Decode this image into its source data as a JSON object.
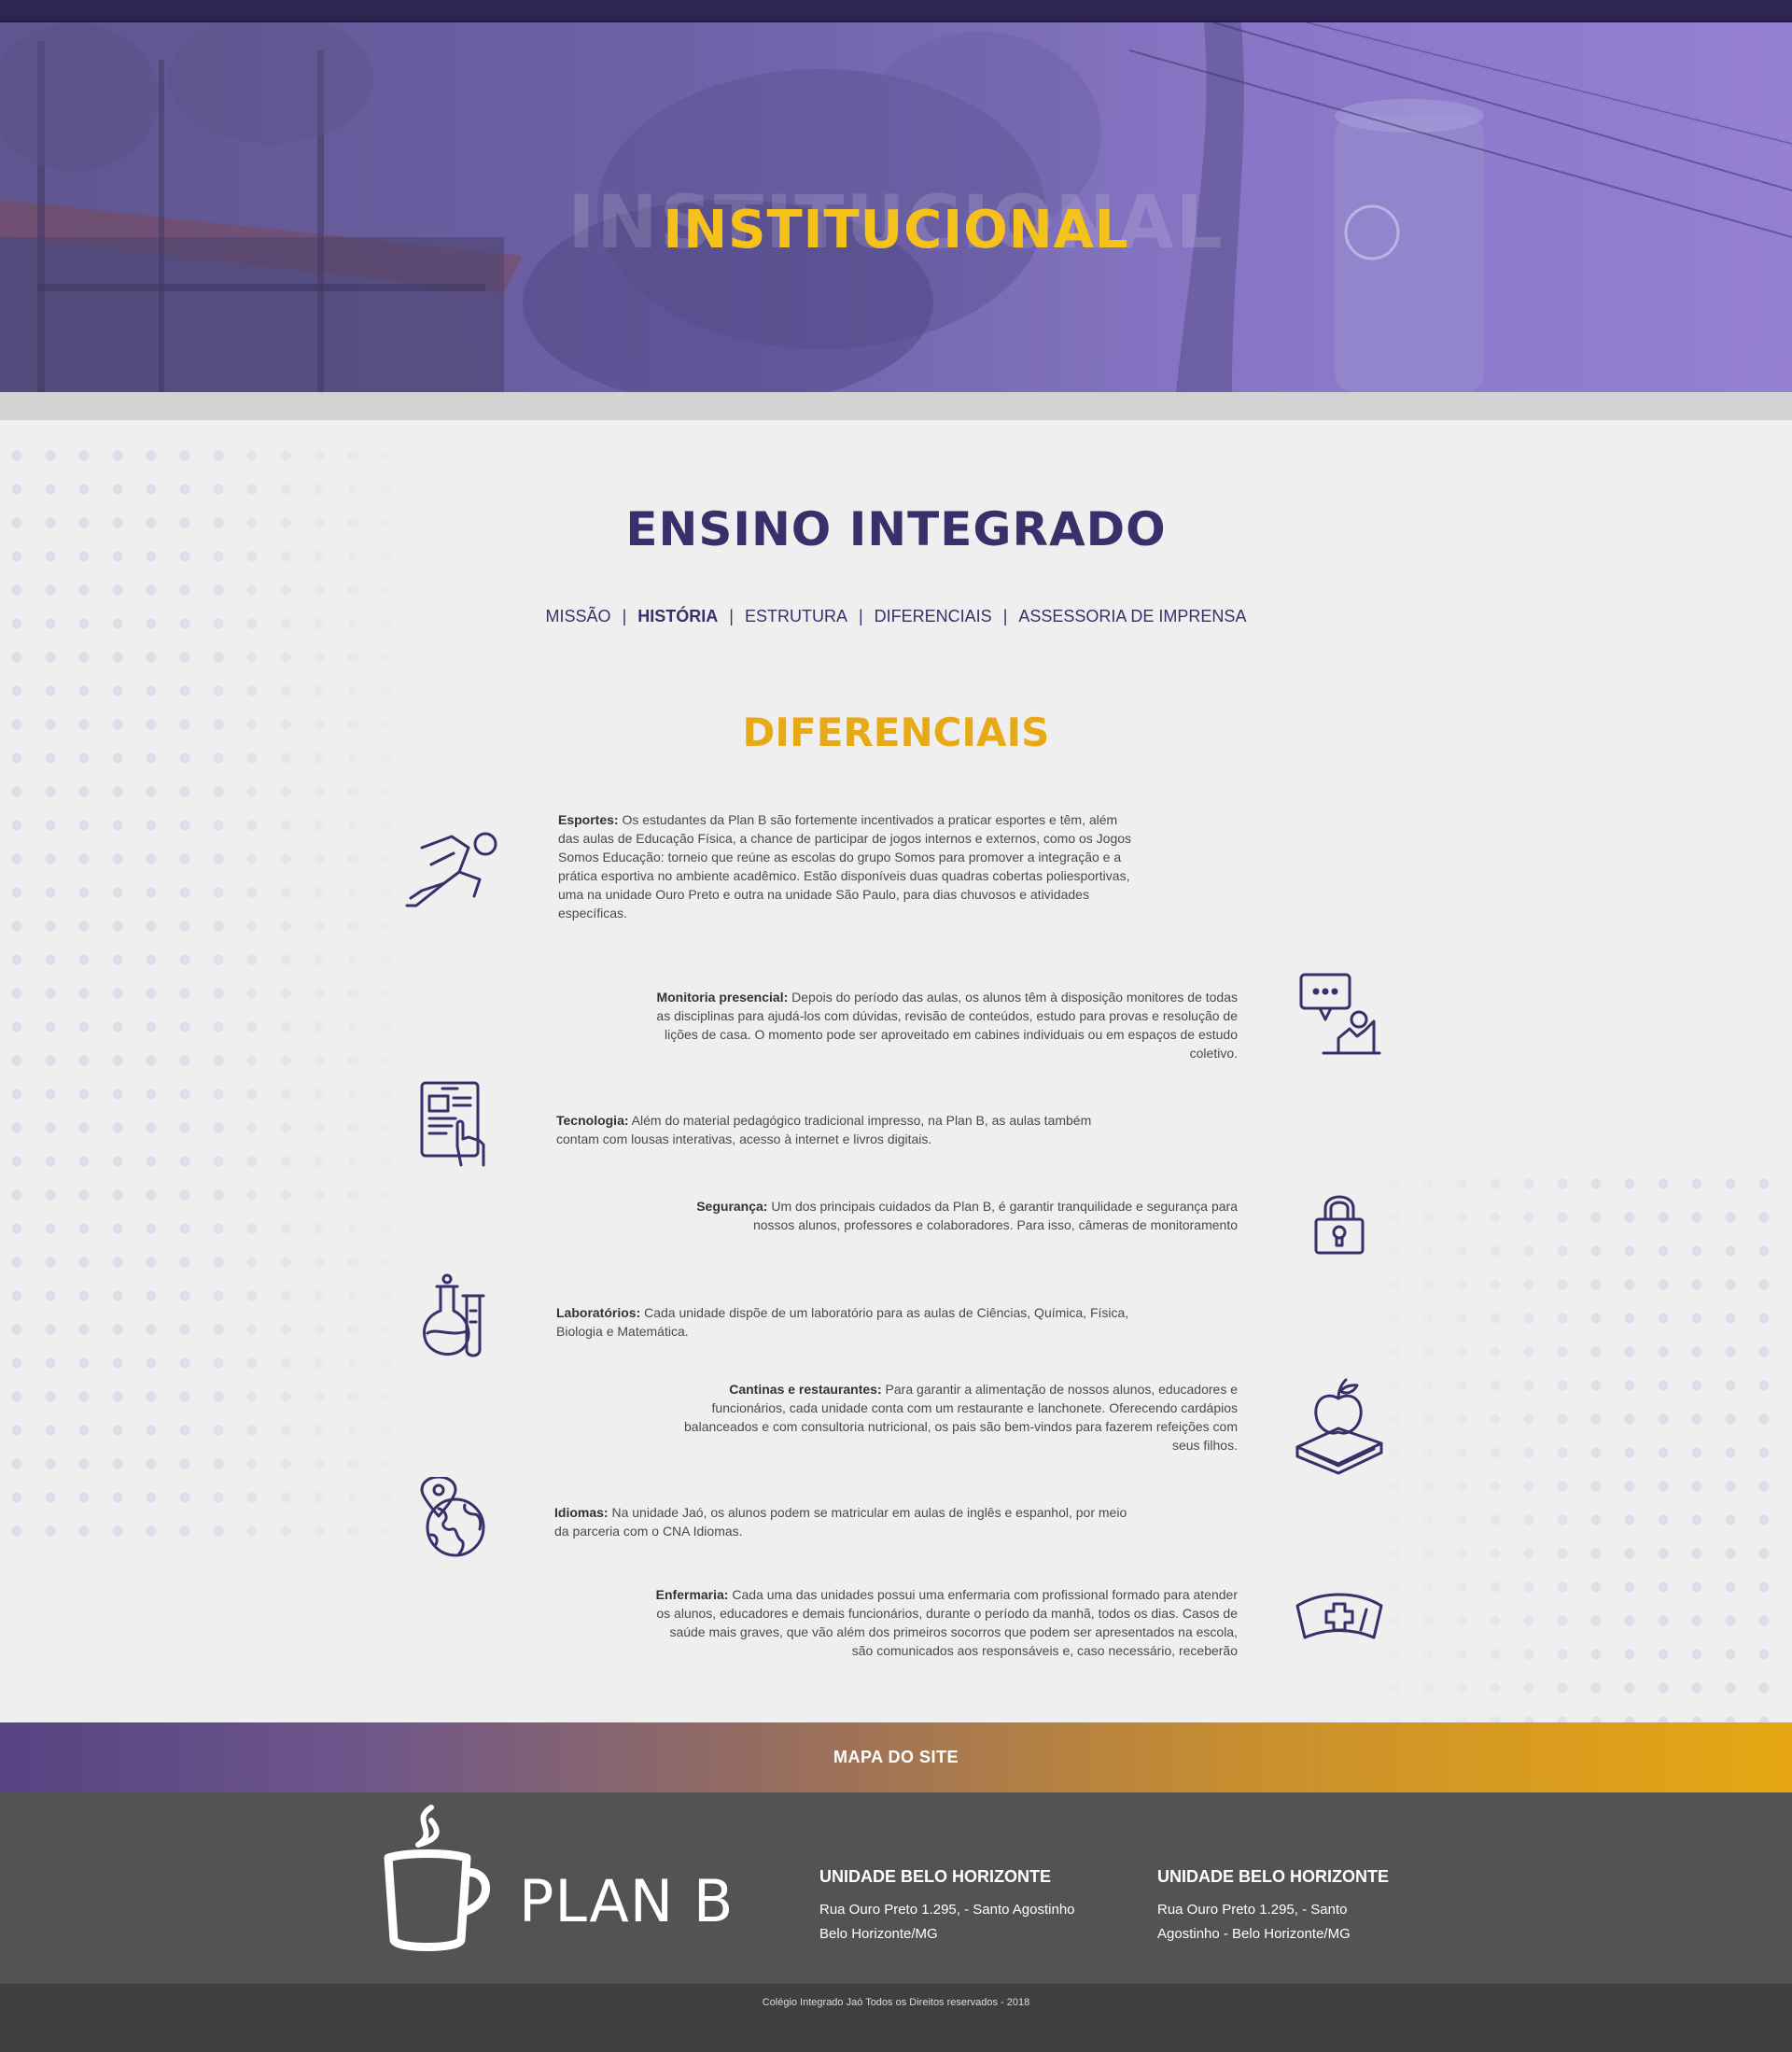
{
  "hero": {
    "ghost_title": "INSTITUCIONAL",
    "title": "INSTITUCIONAL"
  },
  "page_title": "ENSINO INTEGRADO",
  "subnav": {
    "items": [
      "MISSÃO",
      "HISTÓRIA",
      "ESTRUTURA",
      "DIFERENCIAIS",
      "ASSESSORIA DE IMPRENSA"
    ],
    "separator": "|",
    "active": "HISTÓRIA"
  },
  "section_title": "DIFERENCIAIS",
  "features": [
    {
      "title": "Esportes:",
      "text": "Os estudantes da Plan B são fortemente incentivados a praticar esportes e têm, além das aulas de Educação Física, a chance de participar de jogos internos e externos, como os Jogos Somos Educação: torneio que reúne as escolas do grupo Somos para promover a integração e a prática esportiva no ambiente acadêmico. Estão disponíveis duas quadras cobertas poliesportivas, uma na unidade Ouro Preto e outra na unidade São Paulo, para dias chuvosos e atividades específicas.",
      "icon": "running-person-icon"
    },
    {
      "title": "Monitoria presencial:",
      "text": "Depois do período das aulas, os alunos têm à disposição monitores de todas as disciplinas para ajudá-los com dúvidas, revisão de conteúdos, estudo para provas e resolução de lições de casa. O momento pode ser aproveitado em cabines individuais ou em espaços de estudo coletivo.",
      "icon": "speech-bubble-person-icon"
    },
    {
      "title": "Tecnologia:",
      "text": "Além do material pedagógico tradicional impresso, na Plan B, as aulas também contam com lousas interativas, acesso à internet e livros digitais.",
      "icon": "tablet-touch-icon"
    },
    {
      "title": "Segurança:",
      "text": "Um dos principais cuidados da Plan B, é garantir tranquilidade e segurança para nossos alunos, professores e colaboradores. Para isso, câmeras de monitoramento",
      "icon": "padlock-icon"
    },
    {
      "title": "Laboratórios:",
      "text": "Cada unidade dispõe de um laboratório para as aulas de Ciências, Química, Física, Biologia e Matemática.",
      "icon": "lab-flask-icon"
    },
    {
      "title": "Cantinas e restaurantes:",
      "text": "Para garantir a alimentação de nossos alunos, educadores e funcionários, cada unidade conta com um restaurante e lanchonete. Oferecendo cardápios balanceados e com consultoria nutricional, os pais são bem-vindos para fazerem refeições com seus filhos.",
      "icon": "apple-book-icon"
    },
    {
      "title": "Idiomas:",
      "text": "Na unidade Jaó, os alunos podem se matricular em aulas de inglês e espanhol, por meio da parceria com o CNA Idiomas.",
      "icon": "globe-pin-icon"
    },
    {
      "title": "Enfermaria:",
      "text": "Cada uma das unidades possui uma enfermaria com profissional formado para atender os alunos, educadores e demais funcionários, durante o período da manhã, todos os dias. Casos de saúde mais graves, que vão além dos primeiros socorros que podem ser apresentados na escola, são comunicados aos responsáveis e, caso necessário, receberão",
      "icon": "nurse-cap-icon"
    }
  ],
  "sitemap_label": "MAPA DO SITE",
  "footer": {
    "logo_text": "PLAN B",
    "units": [
      {
        "title": "UNIDADE BELO HORIZONTE",
        "line1": "Rua Ouro Preto 1.295, - Santo Agostinho",
        "line2": "Belo Horizonte/MG"
      },
      {
        "title": "UNIDADE BELO HORIZONTE",
        "line1": "Rua Ouro Preto 1.295, - Santo",
        "line2": "Agostinho - Belo Horizonte/MG"
      }
    ],
    "copyright": "Colégio Integrado Jaó Todos os Direitos reservados - 2018"
  },
  "colors": {
    "purple": "#3b2f6b",
    "yellow": "#f4c21a",
    "orange": "#e8a917",
    "footer_bg": "#535353"
  }
}
